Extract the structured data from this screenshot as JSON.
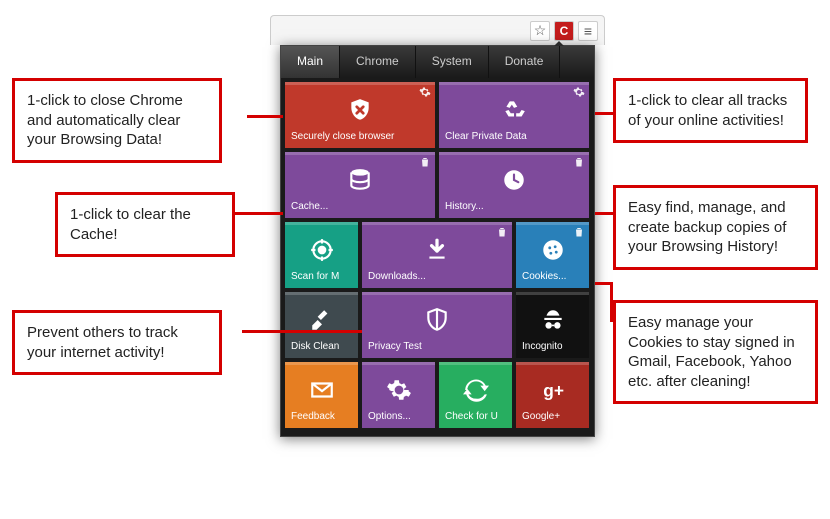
{
  "browser": {
    "ext_letter": "C"
  },
  "tabs": [
    "Main",
    "Chrome",
    "System",
    "Donate"
  ],
  "tiles": {
    "secure_close": "Securely close browser",
    "clear_private": "Clear Private Data",
    "cache": "Cache...",
    "history": "History...",
    "scan": "Scan for M",
    "downloads": "Downloads...",
    "cookies": "Cookies...",
    "disk": "Disk Clean",
    "privacy": "Privacy Test",
    "incognito": "Incognito",
    "feedback": "Feedback",
    "options": "Options...",
    "check": "Check for U",
    "google": "Google+"
  },
  "callouts": {
    "c1": "1-click to close Chrome and automatically clear your Browsing Data!",
    "c2": "1-click to clear all tracks of your online activities!",
    "c3": "1-click to clear the Cache!",
    "c4": "Easy find, manage, and create backup copies of your Browsing History!",
    "c5": "Prevent others to track your internet activity!",
    "c6": "Easy manage your Cookies to stay signed in Gmail, Facebook, Yahoo etc. after cleaning!"
  }
}
